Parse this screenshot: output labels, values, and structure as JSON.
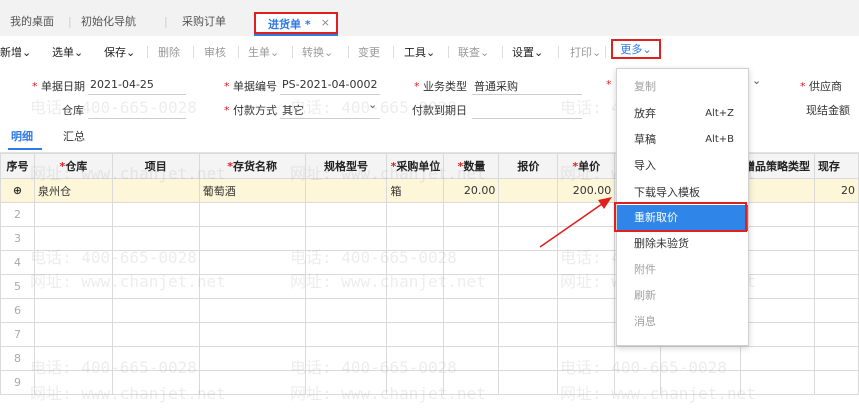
{
  "tabs": {
    "items": [
      "我的桌面",
      "初始化导航",
      "采购订单"
    ],
    "active": "进货单 *",
    "close": "×"
  },
  "toolbar": {
    "new": "新增",
    "select": "选单",
    "save": "保存",
    "delete": "删除",
    "audit": "审核",
    "generate": "生单",
    "convert": "转换",
    "change": "变更",
    "tools": "工具",
    "linked": "联查",
    "settings": "设置",
    "print": "打印",
    "more": "更多"
  },
  "form": {
    "date_label": "单据日期",
    "date_value": "2021-04-25",
    "docno_label": "单据编号",
    "docno_value": "PS-2021-04-0002",
    "biztype_label": "业务类型",
    "biztype_value": "普通采购",
    "supplier_label": "供应商",
    "warehouse_label": "仓库",
    "payment_label": "付款方式",
    "payment_value": "其它",
    "duedate_label": "付款到期日",
    "cash_label": "现结金额"
  },
  "subtabs": [
    "明细",
    "汇总"
  ],
  "grid": {
    "headers": [
      "序号",
      "仓库",
      "项目",
      "存货名称",
      "规格型号",
      "采购单位",
      "数量",
      "报价",
      "单价",
      "",
      "",
      "赠品策略类型",
      "现存"
    ],
    "required": [
      false,
      true,
      false,
      true,
      false,
      true,
      true,
      false,
      true,
      false,
      false,
      false,
      false
    ],
    "row1": [
      "",
      "泉州仓",
      "",
      "葡萄酒",
      "",
      "箱",
      "20.00",
      "",
      "200.00",
      "",
      "",
      "",
      "20"
    ],
    "row_numbers": [
      "2",
      "3",
      "4",
      "5",
      "6",
      "7",
      "8",
      "9"
    ]
  },
  "menu": {
    "items": [
      {
        "label": "复制",
        "shortcut": "",
        "disabled": true
      },
      {
        "label": "放弃",
        "shortcut": "Alt+Z",
        "disabled": false
      },
      {
        "label": "草稿",
        "shortcut": "Alt+B",
        "disabled": false
      },
      {
        "label": "导入",
        "shortcut": "",
        "disabled": false
      },
      {
        "label": "下载导入模板",
        "shortcut": "",
        "disabled": false
      },
      {
        "label": "重新取价",
        "shortcut": "",
        "disabled": false,
        "highlighted": true
      },
      {
        "label": "删除未验货",
        "shortcut": "",
        "disabled": false
      },
      {
        "label": "附件",
        "shortcut": "",
        "disabled": true
      },
      {
        "label": "刷新",
        "shortcut": "",
        "disabled": true
      },
      {
        "label": "消息",
        "shortcut": "",
        "disabled": true
      }
    ]
  },
  "watermark": {
    "phone": "电话: 400-665-0028",
    "site": "网址: www.chanjet.net"
  },
  "colors": {
    "accent": "#2f7ae5",
    "highlight": "#2f86e8",
    "annotation": "#e02020",
    "row_selected": "#fdf6d8"
  }
}
